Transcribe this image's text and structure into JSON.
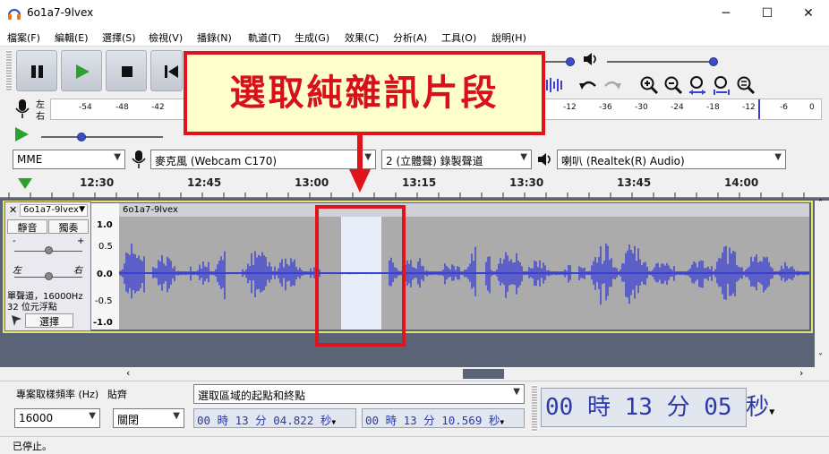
{
  "window": {
    "title": "6o1a7-9lvex",
    "minimize": "─",
    "maximize": "☐",
    "close": "✕"
  },
  "menu": [
    "檔案(F)",
    "編輯(E)",
    "選擇(S)",
    "檢視(V)",
    "播錄(N)",
    "軌道(T)",
    "生成(G)",
    "效果(C)",
    "分析(A)",
    "工具(O)",
    "說明(H)"
  ],
  "meter": {
    "channel_top": "左",
    "channel_bottom": "右",
    "scale": [
      "-54",
      "-48",
      "-42",
      "-12",
      "-36",
      "-30",
      "-24",
      "-18",
      "-12",
      "-6",
      "0"
    ]
  },
  "devices": {
    "host": "MME",
    "microphone": "麥克風 (Webcam C170)",
    "channels": "2 (立體聲) 錄製聲道",
    "speaker": "喇叭 (Realtek(R) Audio)"
  },
  "ruler": [
    "12:30",
    "12:45",
    "13:00",
    "13:15",
    "13:30",
    "13:45",
    "14:00"
  ],
  "track": {
    "name": "6o1a7-9lvex",
    "header_name": "6o1a7-9lvex",
    "mute": "靜音",
    "solo": "獨奏",
    "gain_minus": "-",
    "gain_plus": "+",
    "pan_left": "左",
    "pan_right": "右",
    "info_line1": "單聲道，16000Hz",
    "info_line2": "32 位元浮點",
    "select": "選擇",
    "close": "✕",
    "menu_arrow": "▼",
    "yscale": [
      "1.0",
      "0.5",
      "0.0",
      "-0.5",
      "-1.0"
    ]
  },
  "selection_toolbar": {
    "rate_label": "專案取樣頻率 (Hz)",
    "snap_label": "貼齊",
    "rate_value": "16000",
    "snap_value": "關閉",
    "mode": "選取區域的起點和終點",
    "start": "00 時 13 分 04.822 秒",
    "end": "00 時 13 分 10.569 秒",
    "big_time": "00 時 13 分 05 秒"
  },
  "status": "已停止。",
  "callout": "選取純雜訊片段",
  "colors": {
    "waveform": "#3b3fd1",
    "selection": "#e8eef9",
    "accent": "#e0141c"
  },
  "icons": [
    "audacity-logo-icon",
    "pause-icon",
    "play-icon",
    "stop-icon",
    "skip-start-icon",
    "speaker-icon",
    "microphone-icon",
    "undo-icon",
    "redo-icon",
    "zoom-in-icon",
    "zoom-out-icon",
    "fit-selection-icon",
    "fit-project-icon",
    "zoom-toggle-icon",
    "play-at-speed-icon",
    "playback-meter-arrow-icon"
  ]
}
